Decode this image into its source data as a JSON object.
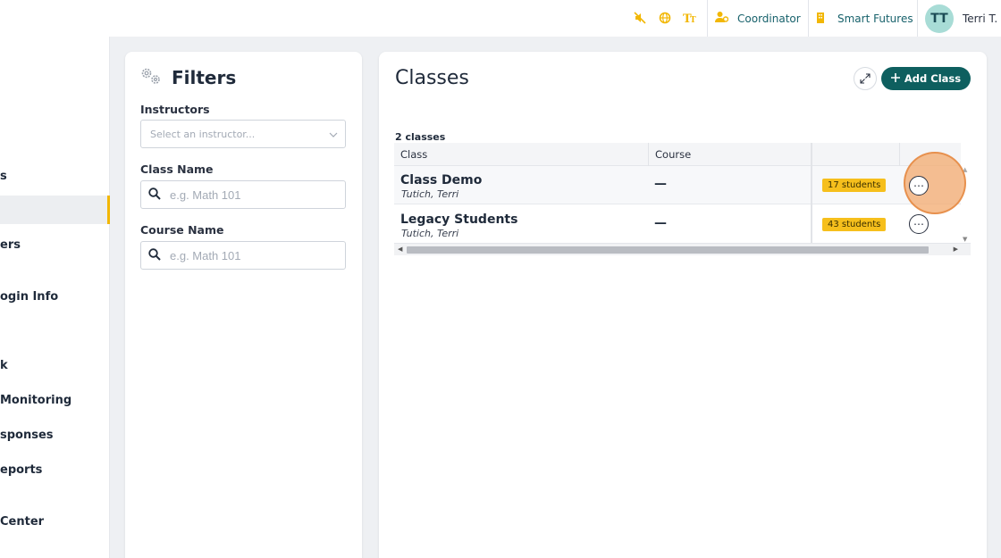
{
  "topbar": {
    "icons": [
      "mute-icon",
      "globe-icon",
      "text-size-icon"
    ],
    "role_icon": "user-role-icon",
    "role_label": "Coordinator",
    "org_icon": "building-icon",
    "org_label": "Smart Futures",
    "avatar_initials": "TT",
    "user_name": "Terri T."
  },
  "sidebar": {
    "items": [
      {
        "label": "s",
        "active": false
      },
      {
        "label": "",
        "active": true
      },
      {
        "label": "ers",
        "active": false
      },
      {
        "label": "ogin Info",
        "active": false
      },
      {
        "label": "k",
        "active": false
      },
      {
        "label": "Monitoring",
        "active": false
      },
      {
        "label": "sponses",
        "active": false
      },
      {
        "label": "eports",
        "active": false
      },
      {
        "label": "Center",
        "active": false
      }
    ]
  },
  "filters": {
    "title": "Filters",
    "instructors_label": "Instructors",
    "instructors_placeholder": "Select an instructor...",
    "class_name_label": "Class Name",
    "class_name_placeholder": "e.g. Math 101",
    "course_name_label": "Course Name",
    "course_name_placeholder": "e.g. Math 101"
  },
  "classes": {
    "title": "Classes",
    "add_button": "Add Class",
    "count": "2 classes",
    "columns": [
      "Class",
      "Course"
    ],
    "rows": [
      {
        "name": "Class Demo",
        "instructor": "Tutich, Terri",
        "course": "—",
        "students": "17 students"
      },
      {
        "name": "Legacy Students",
        "instructor": "Tutich, Terri",
        "course": "—",
        "students": "43 students"
      }
    ]
  },
  "colors": {
    "accent": "#f2b705",
    "primary": "#0e5f5f",
    "badge": "#f6bf1c",
    "highlight": "#f3aa6e"
  }
}
